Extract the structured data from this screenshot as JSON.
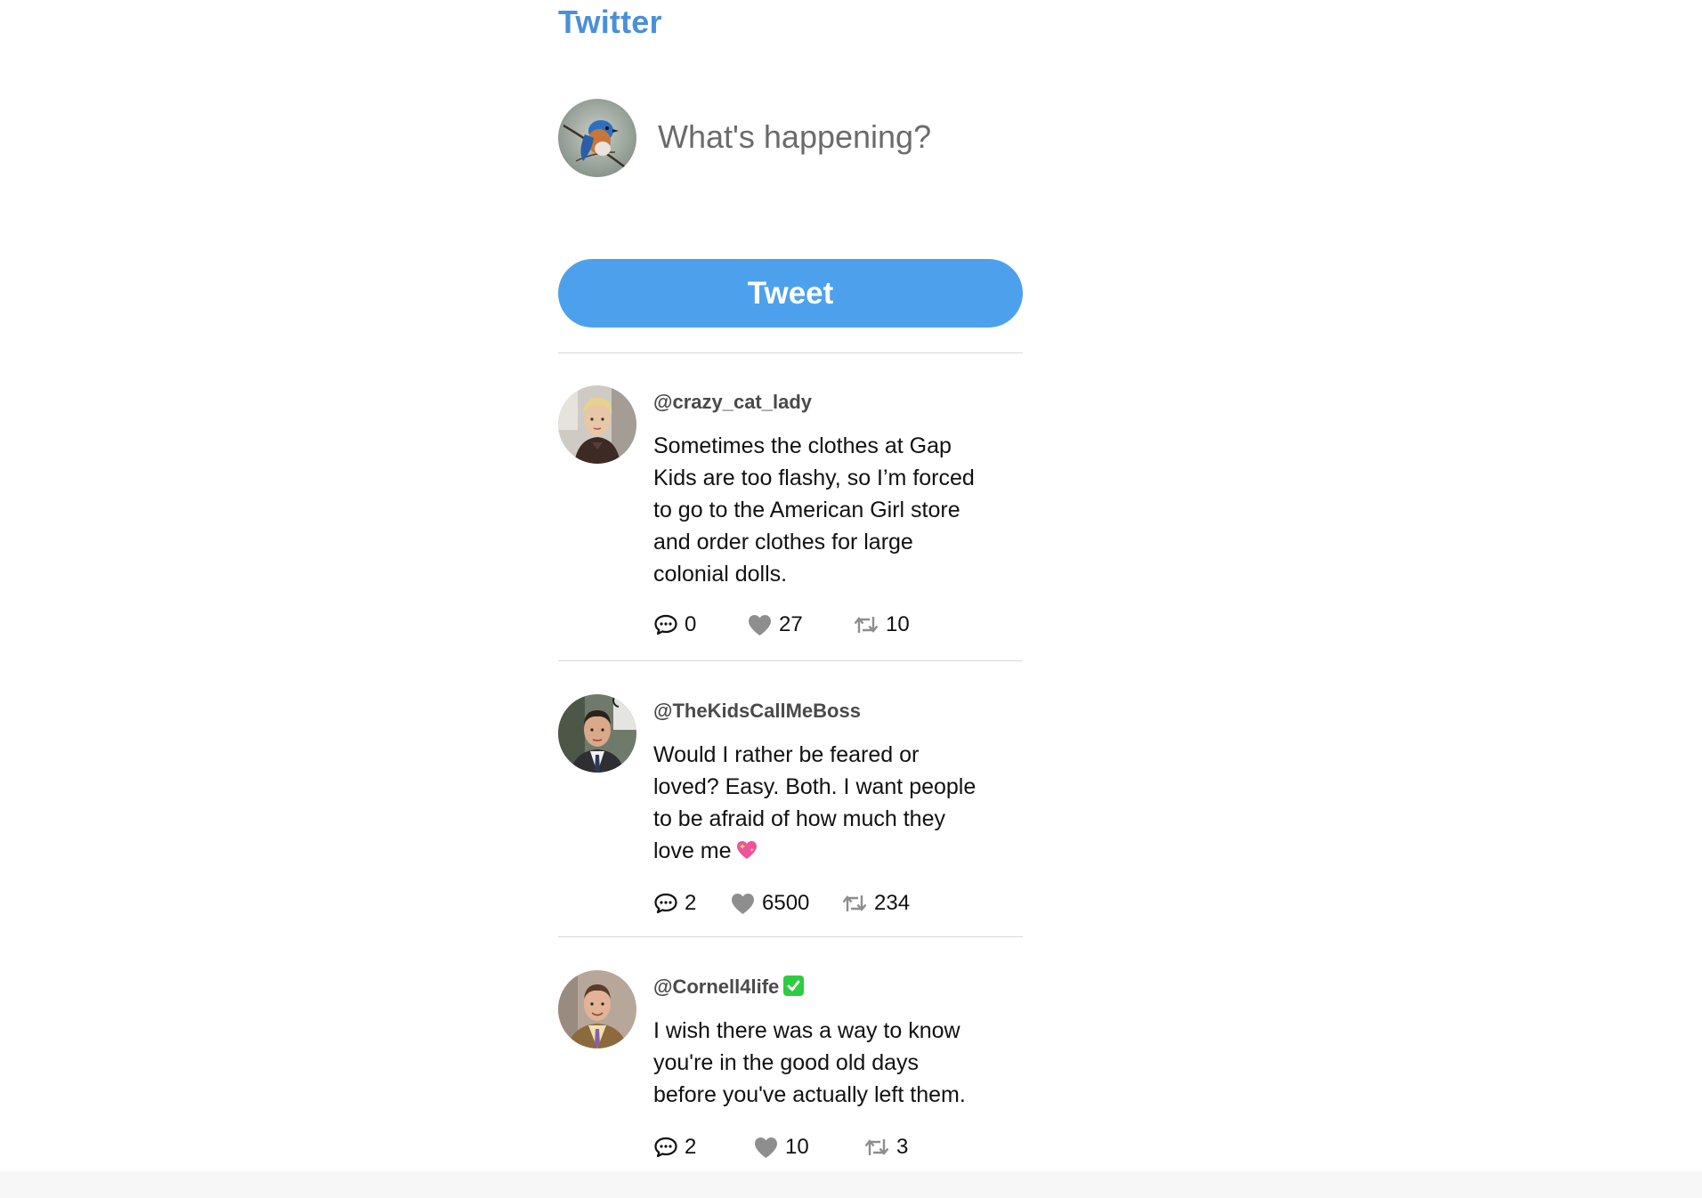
{
  "app": {
    "brand": "Twitter"
  },
  "composer": {
    "placeholder": "What's happening?",
    "avatar_icon": "bluebird-avatar",
    "submit_label": "Tweet"
  },
  "tweets": [
    {
      "handle": "@crazy_cat_lady",
      "verified": false,
      "body": "Sometimes the clothes at Gap Kids are too flashy, so I’m forced to go to the American Girl store and order clothes for large colonial dolls.",
      "emoji": "",
      "comments": "0",
      "likes": "27",
      "retweets": "10"
    },
    {
      "handle": "@TheKidsCallMeBoss",
      "verified": false,
      "body": "Would I rather be feared or loved? Easy. Both. I want people to be afraid of how much they love me",
      "emoji": "sparkling-heart",
      "comments": "2",
      "likes": "6500",
      "retweets": "234"
    },
    {
      "handle": "@Cornell4life",
      "verified": true,
      "body": "I wish there was a way to know you're in the good old days before you've actually left them.",
      "emoji": "",
      "comments": "2",
      "likes": "10",
      "retweets": "3"
    }
  ],
  "colors": {
    "brand": "#4a90d9",
    "tweet_button": "#4da1ec",
    "divider": "#d8d8d8",
    "verified": "#2ecc40",
    "icon_gray": "#8e8e8e"
  }
}
